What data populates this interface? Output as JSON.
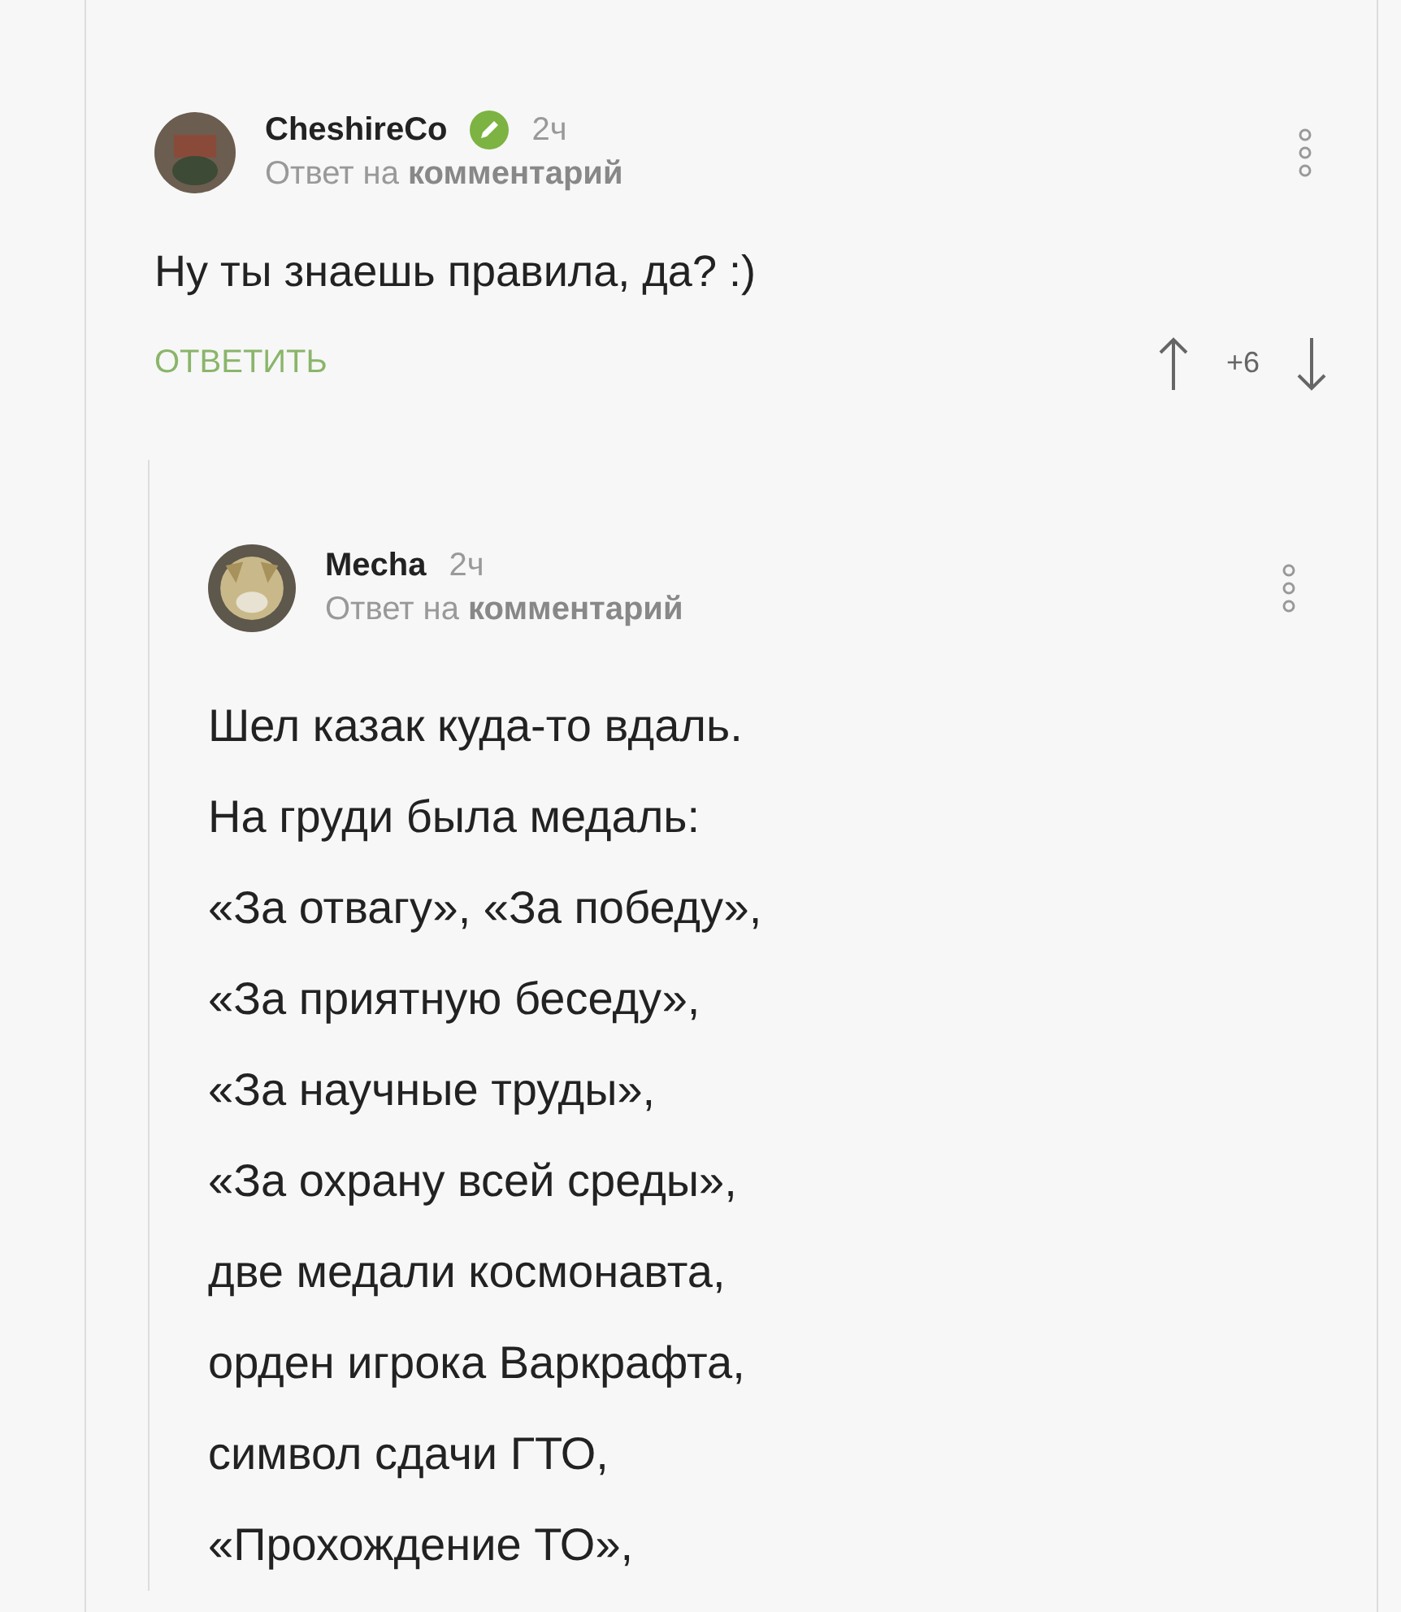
{
  "comments": [
    {
      "author": "CheshireCo",
      "verified": true,
      "time": "2ч",
      "reply_to": "Ответ на **комментарий**",
      "body": [
        "Ну ты знаешь правила, да? :)"
      ],
      "reply_button": "ОТВЕТИТЬ",
      "rating": "+6",
      "children": [
        {
          "author": "Mecha",
          "verified": false,
          "time": "2ч",
          "reply_to": "Ответ на **комментарий**",
          "body": [
            "Шел казак куда-то вдаль.",
            "На груди была медаль:",
            "«За отвагу», «За победу»,",
            "«За приятную беседу»,",
            "«За научные труды»,",
            "«За охрану всей среды»,",
            "две медали космонавта,",
            "орден игрока Варкрафта,",
            "символ сдачи ГТО,",
            "«Прохождение ТО»,"
          ]
        }
      ]
    }
  ]
}
